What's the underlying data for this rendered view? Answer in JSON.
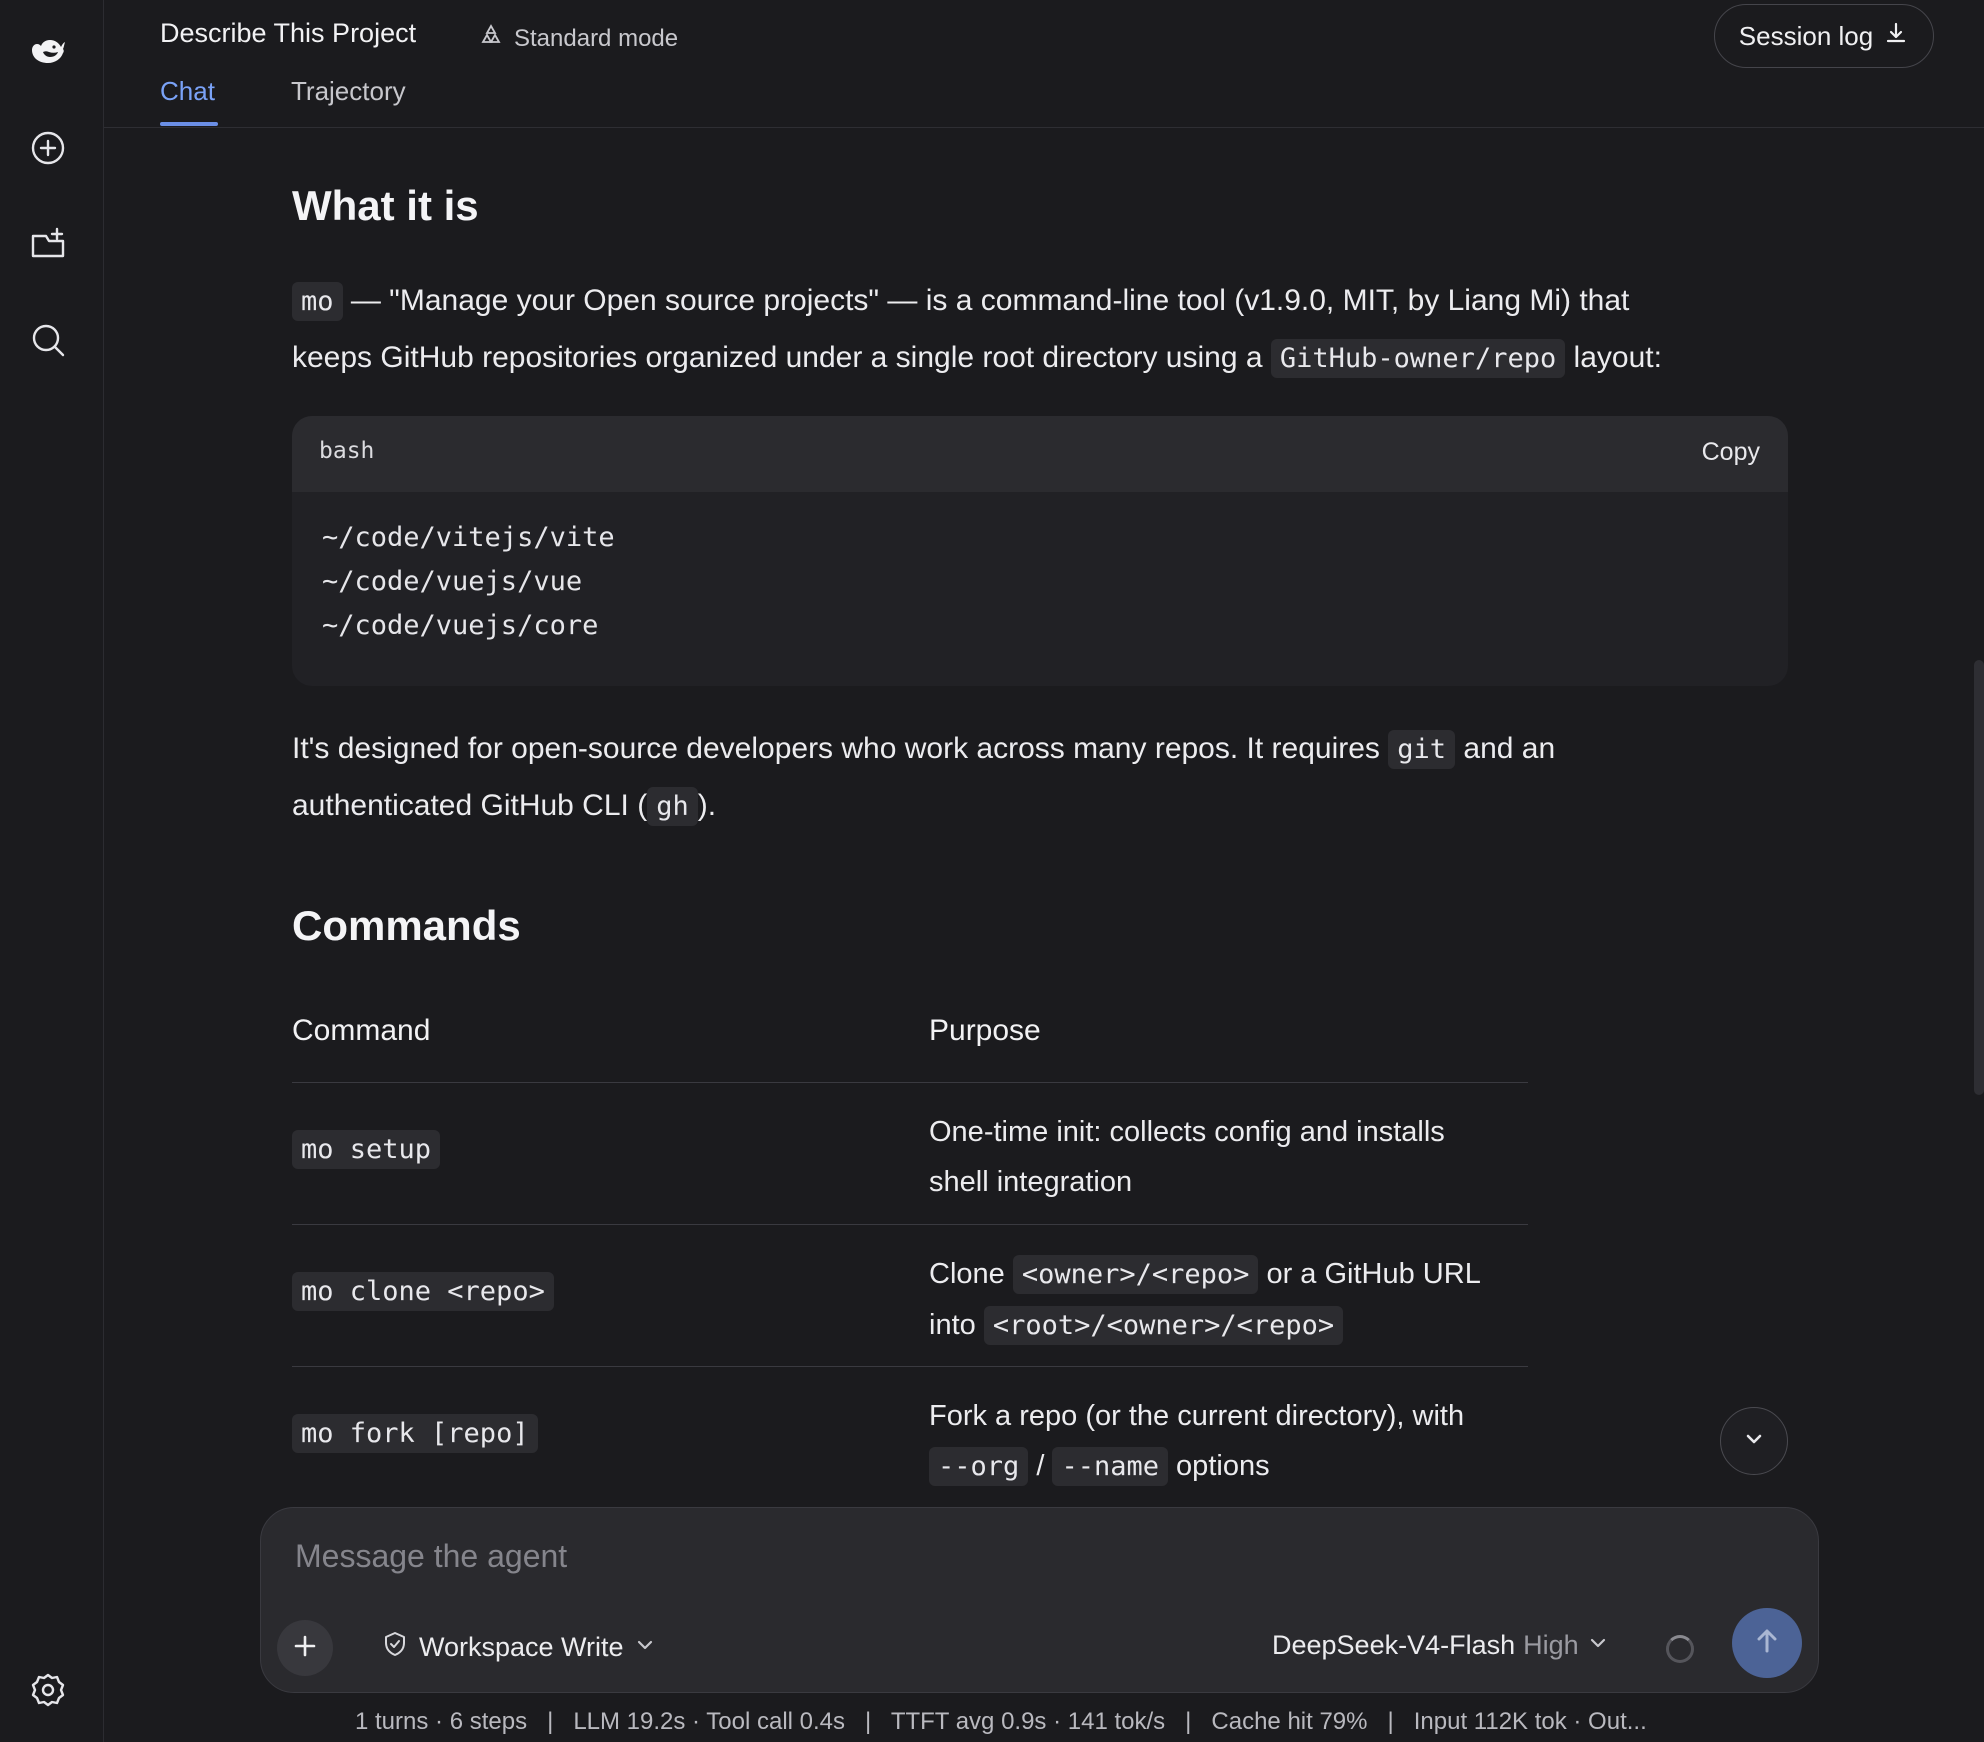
{
  "sidebar": {
    "items": [
      {
        "icon": "whale-logo-icon"
      },
      {
        "icon": "new-chat-icon"
      },
      {
        "icon": "new-folder-icon"
      },
      {
        "icon": "search-icon"
      },
      {
        "icon": "gear-icon"
      }
    ]
  },
  "header": {
    "title": "Describe This Project",
    "mode": "Standard mode",
    "tabs": [
      {
        "label": "Chat",
        "active": true
      },
      {
        "label": "Trajectory",
        "active": false
      }
    ],
    "session_log": "Session log"
  },
  "content": {
    "section1": {
      "heading": "What it is",
      "p1_code1": "mo",
      "p1_text1": " — \"Manage your Open source projects\" — is a command-line tool (v1.9.0, MIT, by Liang Mi) that",
      "p1_text2": "keeps GitHub repositories organized under a single root directory using a ",
      "p1_code2": "GitHub-owner/repo",
      "p1_text3": " layout:",
      "codeblock": {
        "language": "bash",
        "copy_label": "Copy",
        "lines": [
          "~/code/vitejs/vite",
          "~/code/vuejs/vue",
          "~/code/vuejs/core"
        ]
      },
      "p2_text1": "It's designed for open-source developers who work across many repos. It requires ",
      "p2_code1": "git",
      "p2_text2": " and an",
      "p2_text3": "authenticated GitHub CLI (",
      "p2_code2": "gh",
      "p2_text4": ")."
    },
    "section2": {
      "heading": "Commands",
      "columns": [
        "Command",
        "Purpose"
      ],
      "rows": [
        {
          "command": "mo setup",
          "purpose_line1": "One-time init: collects config and installs",
          "purpose_line2": "shell integration"
        },
        {
          "command": "mo clone <repo>",
          "p_text1": "Clone ",
          "p_code1": "<owner>/<repo>",
          "p_text2": " or a GitHub URL",
          "p_text3": "into ",
          "p_code2": "<root>/<owner>/<repo>"
        },
        {
          "command": "mo fork [repo]",
          "p_text1": "Fork a repo (or the current directory), with",
          "p_code1": "--org",
          "p_sep": " / ",
          "p_code2": "--name",
          "p_text2": " options"
        }
      ]
    }
  },
  "composer": {
    "placeholder": "Message the agent",
    "permission": "Workspace Write",
    "model": "DeepSeek-V4-Flash",
    "effort": "High"
  },
  "status_bar": "1 turns · 6 steps   |   LLM 19.2s · Tool call 0.4s   |   TTFT avg 0.9s · 141 tok/s   |   Cache hit 79%   |   Input 112K tok · Out..."
}
